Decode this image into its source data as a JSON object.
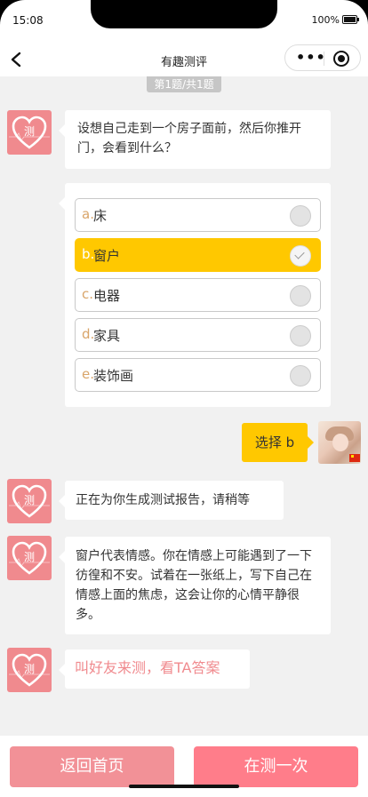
{
  "status_bar": {
    "time": "15:08",
    "battery_text": "100%",
    "battery_level": 1.0
  },
  "nav": {
    "title": "有趣测评",
    "menu_icon": "more-dots-icon",
    "close_icon": "target-icon",
    "back_icon": "chevron-left-icon"
  },
  "progress": {
    "label": "第1题/共1题"
  },
  "bot": {
    "avatar_text": "测",
    "avatar_color": "#f08a8e"
  },
  "question": {
    "text": "设想自己走到一个房子面前，然后你推开门，会看到什么？"
  },
  "options": [
    {
      "letter": "a.",
      "label": "床",
      "selected": false
    },
    {
      "letter": "b.",
      "label": "窗户",
      "selected": true
    },
    {
      "letter": "c.",
      "label": "电器",
      "selected": false
    },
    {
      "letter": "d.",
      "label": "家具",
      "selected": false
    },
    {
      "letter": "e.",
      "label": "装饰画",
      "selected": false
    }
  ],
  "user_answer": {
    "text": "选择 b"
  },
  "messages": {
    "generating": "正在为你生成测试报告，请稍等",
    "result": "窗户代表情感。你在情感上可能遇到了一下彷徨和不安。试着在一张纸上，写下自己在情感上面的焦虑，这会让你的心情平静很多。",
    "share": "叫好友来测，看TA答案"
  },
  "buttons": {
    "home": "返回首页",
    "retry": "在测一次"
  },
  "colors": {
    "accent_yellow": "#ffc800",
    "pink": "#f08a8e",
    "button_home": "#f29197",
    "button_retry": "#ff7d8a"
  }
}
